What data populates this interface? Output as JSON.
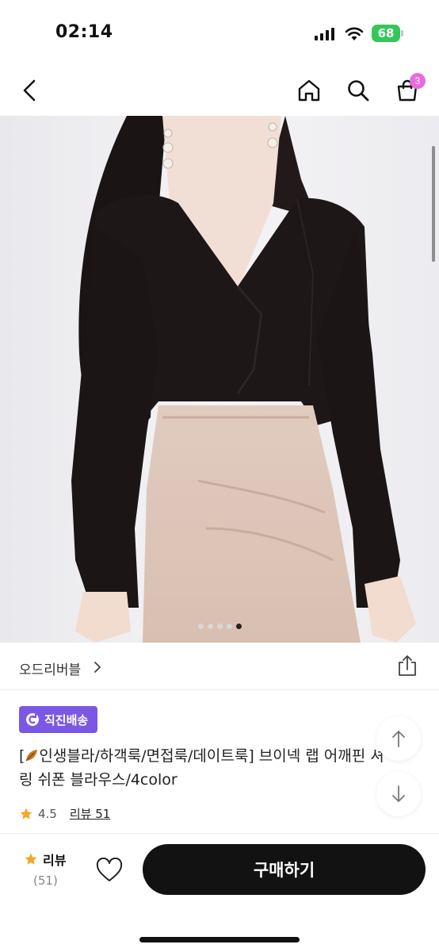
{
  "status_bar": {
    "time": "02:14",
    "battery": "68"
  },
  "nav": {
    "cart_count": "3"
  },
  "gallery": {
    "page_count": 5,
    "current_page": 5
  },
  "brand": {
    "name": "오드리버블"
  },
  "delivery_badge": {
    "label": "직진배송",
    "color": "#7a58e3"
  },
  "product": {
    "title_line1": "[",
    "title_text": "인생블라/하객룩/면접룩/데이트룩] 브이넥 랩 어깨핀",
    "title_tail": "셔",
    "title_line2": "링 쉬폰 블라우스/4color"
  },
  "rating": {
    "score": "4.5",
    "review_link": "리뷰 51"
  },
  "bottom_bar": {
    "review_label": "리뷰",
    "review_count": "(51)",
    "buy_label": "구매하기"
  },
  "colors": {
    "accent": "#7a58e3",
    "badge": "#e96bdc",
    "star": "#f5a623",
    "button": "#121212"
  }
}
